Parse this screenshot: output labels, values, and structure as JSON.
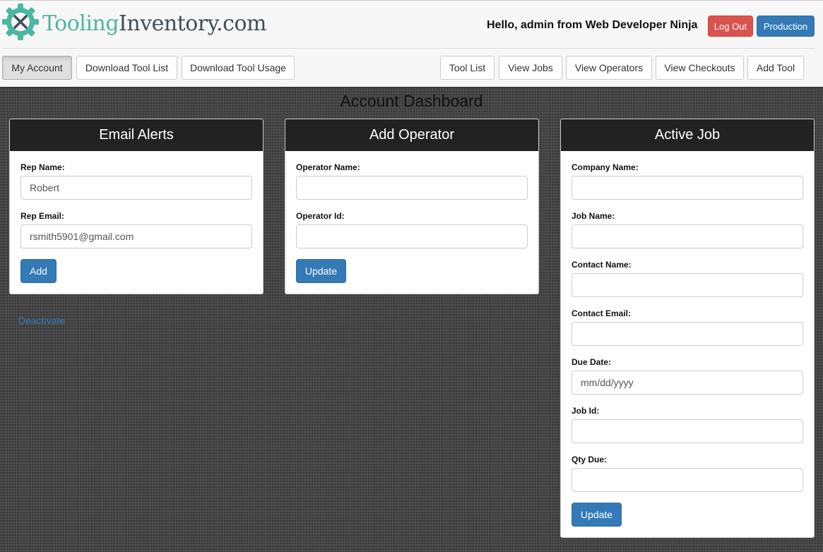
{
  "brand": {
    "name_part1": "Tooling",
    "name_part2": "Inventory.com"
  },
  "header": {
    "greeting": "Hello, admin from Web Developer Ninja",
    "logout_label": "Log Out",
    "production_label": "Production"
  },
  "nav": {
    "my_account": "My Account",
    "download_tool_list": "Download Tool List",
    "download_tool_usage": "Download Tool Usage",
    "tool_list": "Tool List",
    "view_jobs": "View Jobs",
    "view_operators": "View Operators",
    "view_checkouts": "View Checkouts",
    "add_tool": "Add Tool"
  },
  "page_title": "Account Dashboard",
  "email_alerts": {
    "title": "Email Alerts",
    "rep_name_label": "Rep Name:",
    "rep_name_value": "Robert",
    "rep_email_label": "Rep Email:",
    "rep_email_value": "rsmith5901@gmail.com",
    "add_label": "Add"
  },
  "add_operator": {
    "title": "Add Operator",
    "operator_name_label": "Operator Name:",
    "operator_id_label": "Operator Id:",
    "update_label": "Update"
  },
  "active_job": {
    "title": "Active Job",
    "company_name_label": "Company Name:",
    "job_name_label": "Job Name:",
    "contact_name_label": "Contact Name:",
    "contact_email_label": "Contact Email:",
    "due_date_label": "Due Date:",
    "due_date_placeholder": "mm/dd/yyyy",
    "job_id_label": "Job Id:",
    "qty_due_label": "Qty Due:",
    "update_label": "Update"
  },
  "deactivate_label": "Deactivate",
  "colors": {
    "brand_teal": "#4cb6a2",
    "brand_dark": "#3f4e5a",
    "primary": "#337ab7",
    "danger": "#d9534f",
    "card_header": "#222222"
  }
}
